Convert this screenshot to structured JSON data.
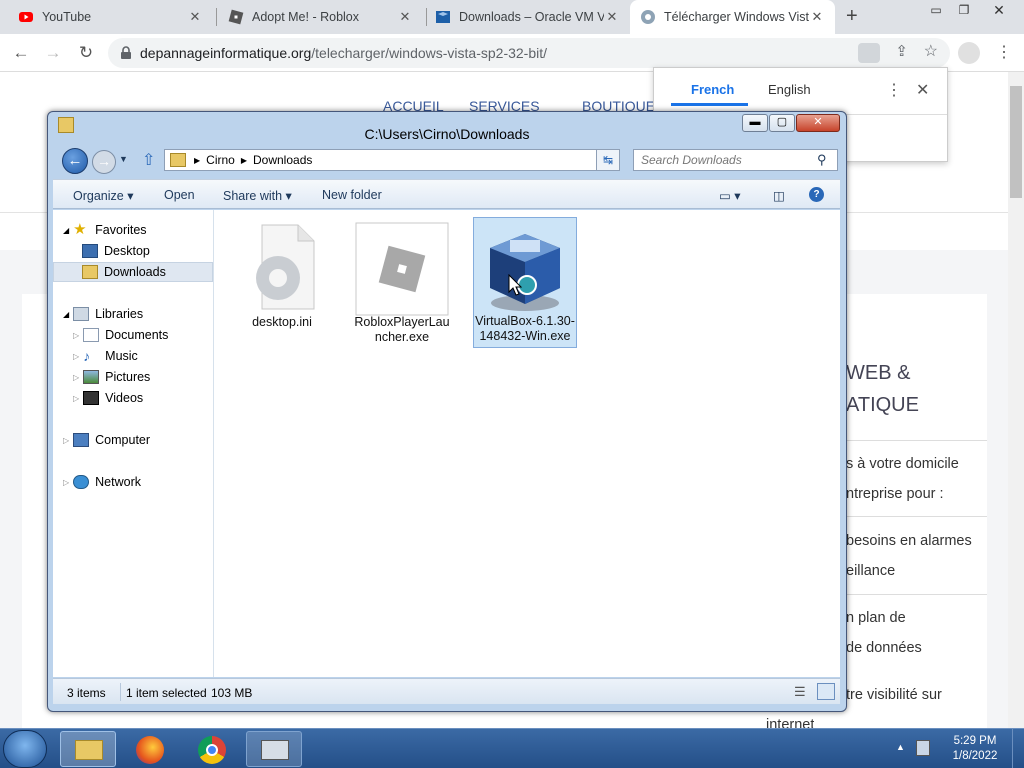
{
  "browser": {
    "tabs": [
      {
        "title": "YouTube",
        "icon": "youtube-icon"
      },
      {
        "title": "Adopt Me! - Roblox",
        "icon": "roblox-icon"
      },
      {
        "title": "Downloads – Oracle VM Vi",
        "icon": "virtualbox-icon"
      },
      {
        "title": "Télécharger Windows Vista",
        "icon": "globe-icon",
        "active": true
      }
    ],
    "url_domain": "depannageinformatique.org",
    "url_path": "/telecharger/windows-vista-sp2-32-bit/"
  },
  "translate_popup": {
    "from_lang": "French",
    "to_lang": "English"
  },
  "background_page": {
    "nav": [
      "ACCUEIL",
      "SERVICES",
      "BOUTIQUE"
    ],
    "heading_lines": [
      "WEB &",
      "ATIQUE"
    ],
    "text_lines": [
      "s à votre domicile",
      "ntreprise pour :",
      "besoins en alarmes",
      "eillance",
      "n plan de",
      "de données",
      "tre visibilité sur",
      "internet"
    ]
  },
  "explorer": {
    "title": "C:\\Users\\Cirno\\Downloads",
    "breadcrumb": [
      "Cirno",
      "Downloads"
    ],
    "search_placeholder": "Search Downloads",
    "commands": {
      "organize": "Organize",
      "open": "Open",
      "share_with": "Share with",
      "new_folder": "New folder"
    },
    "nav": {
      "favorites": "Favorites",
      "desktop": "Desktop",
      "downloads": "Downloads",
      "libraries": "Libraries",
      "documents": "Documents",
      "music": "Music",
      "pictures": "Pictures",
      "videos": "Videos",
      "computer": "Computer",
      "network": "Network"
    },
    "files": [
      {
        "name_lines": [
          "desktop.ini"
        ],
        "icon": "settings-file-icon"
      },
      {
        "name_lines": [
          "RobloxPlayerLau",
          "ncher.exe"
        ],
        "icon": "roblox-icon"
      },
      {
        "name_lines": [
          "VirtualBox-6.1.30-",
          "148432-Win.exe"
        ],
        "icon": "virtualbox-icon",
        "selected": true
      }
    ],
    "status": {
      "item_count": "3 items",
      "selection": "1 item selected",
      "size": "103 MB"
    }
  },
  "taskbar": {
    "time": "5:29 PM",
    "date": "1/8/2022"
  },
  "colors": {
    "window_frame": "#bcd3ec",
    "selection": "#cce4f7",
    "taskbar": "#2d5a93",
    "translate_accent": "#1a73e8"
  }
}
